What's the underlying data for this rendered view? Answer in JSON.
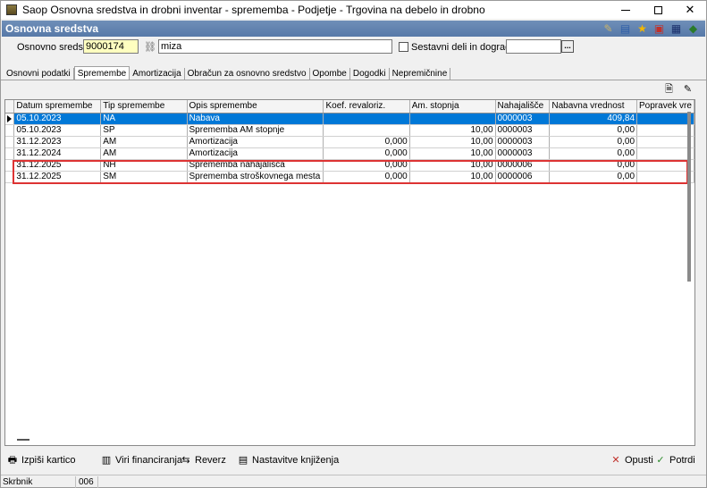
{
  "window": {
    "title": "Saop Osnovna sredstva in drobni inventar - sprememba - Podjetje - Trgovina na debelo in drobno",
    "minimize": "—",
    "maximize": "☐",
    "close": "✕"
  },
  "header": {
    "title": "Osnovna sredstva",
    "icons": [
      "edit-icon",
      "folder-icon",
      "star-icon",
      "save-icon",
      "calculator-icon",
      "export-icon"
    ]
  },
  "form": {
    "asset_label": "Osnovno sredstvo",
    "asset_code": "9000174",
    "asset_name": "miza",
    "composite_label": "Sestavni deli in dogradtve",
    "composite_value": "",
    "dots": "..."
  },
  "tabs": [
    {
      "label": "Osnovni podatki"
    },
    {
      "label": "Spremembe"
    },
    {
      "label": "Amortizacija"
    },
    {
      "label": "Obračun za osnovno sredstvo"
    },
    {
      "label": "Opombe"
    },
    {
      "label": "Dogodki"
    },
    {
      "label": "Nepremičnine"
    }
  ],
  "grid": {
    "columns": [
      "Datum spremembe",
      "Tip spremembe",
      "Opis spremembe",
      "Koef. revaloriz.",
      "Am. stopnja",
      "Nahajališče",
      "Nabavna vrednost",
      "Popravek vre"
    ],
    "rows": [
      {
        "date": "05.10.2023",
        "type": "NA",
        "desc": "Nabava",
        "koef": "",
        "stopnja": "",
        "loc": "0000003",
        "value": "409,84",
        "popravek": ""
      },
      {
        "date": "05.10.2023",
        "type": "SP",
        "desc": "Sprememba AM stopnje",
        "koef": "",
        "stopnja": "10,00",
        "loc": "0000003",
        "value": "0,00",
        "popravek": ""
      },
      {
        "date": "31.12.2023",
        "type": "AM",
        "desc": "Amortizacija",
        "koef": "0,000",
        "stopnja": "10,00",
        "loc": "0000003",
        "value": "0,00",
        "popravek": ""
      },
      {
        "date": "31.12.2024",
        "type": "AM",
        "desc": "Amortizacija",
        "koef": "0,000",
        "stopnja": "10,00",
        "loc": "0000003",
        "value": "0,00",
        "popravek": ""
      },
      {
        "date": "31.12.2025",
        "type": "NH",
        "desc": "Sprememba nahajališča",
        "koef": "0,000",
        "stopnja": "10,00",
        "loc": "0000006",
        "value": "0,00",
        "popravek": ""
      },
      {
        "date": "31.12.2025",
        "type": "SM",
        "desc": "Sprememba stroškovnega mesta",
        "koef": "0,000",
        "stopnja": "10,00",
        "loc": "0000006",
        "value": "0,00",
        "popravek": ""
      }
    ]
  },
  "buttons": {
    "print": "Izpiši kartico",
    "sources": "Viri financiranja",
    "reverse": "Reverz",
    "settings": "Nastavitve knjiženja",
    "cancel": "Opusti",
    "confirm": "Potrdi"
  },
  "status": {
    "user": "Skrbnik",
    "code": "006"
  }
}
